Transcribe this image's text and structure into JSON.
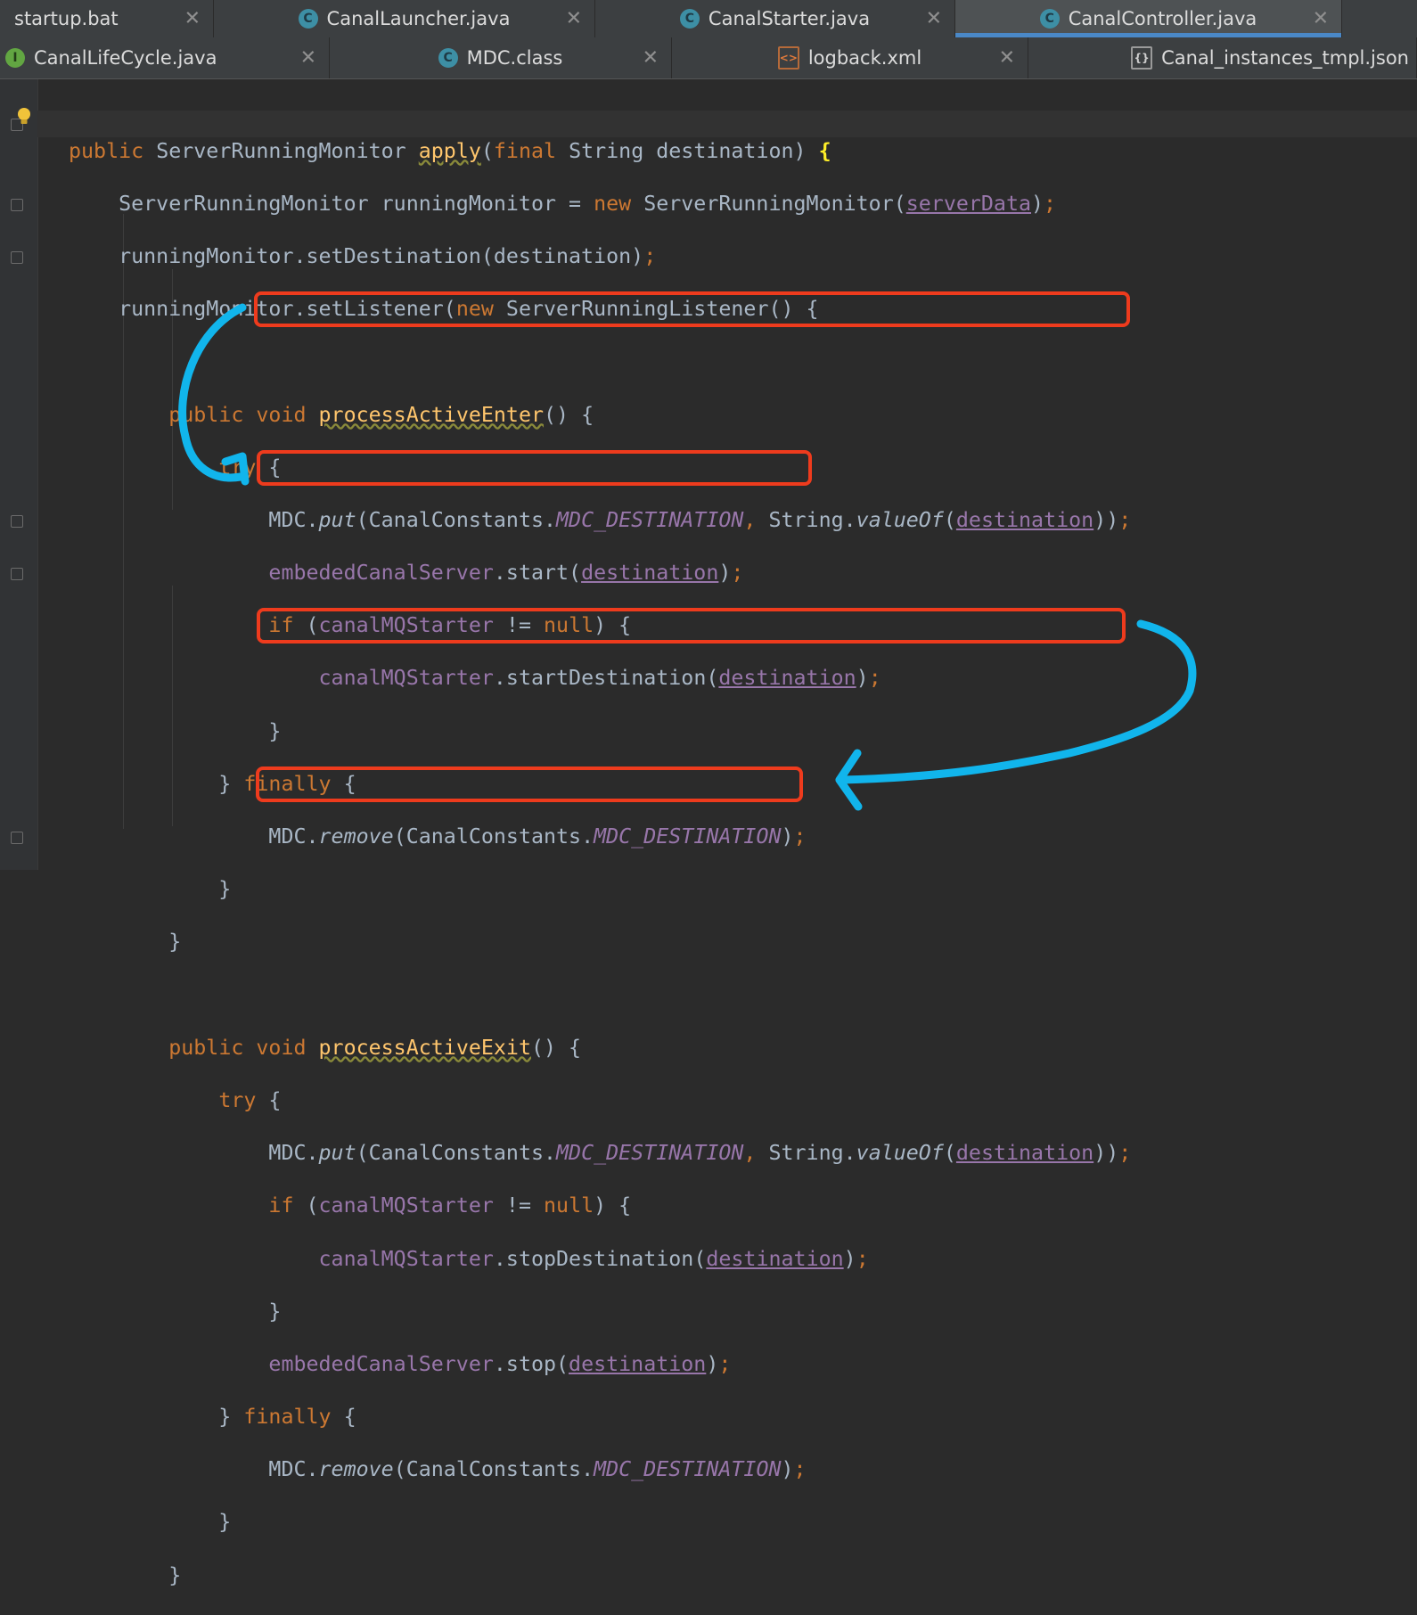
{
  "tabs_row1": [
    {
      "label": "startup.bat",
      "icon": "bat-file-icon",
      "active": false
    },
    {
      "label": "CanalLauncher.java",
      "icon": "class-icon",
      "active": false
    },
    {
      "label": "CanalStarter.java",
      "icon": "class-icon",
      "active": false
    },
    {
      "label": "CanalController.java",
      "icon": "class-icon",
      "active": true
    }
  ],
  "tabs_row2": [
    {
      "label": "CanalLifeCycle.java",
      "icon": "interface-icon"
    },
    {
      "label": "MDC.class",
      "icon": "class-icon"
    },
    {
      "label": "logback.xml",
      "icon": "xml-file-icon"
    },
    {
      "label": "Canal_instances_tmpl.json",
      "icon": "json-file-icon"
    }
  ],
  "icon_letters": {
    "class": "C",
    "interface": "I"
  },
  "close_glyph": "✕",
  "colors": {
    "keyword": "#cc7832",
    "method": "#ffc66d",
    "field": "#9876aa",
    "text": "#a9b7c6",
    "background": "#2b2b2b",
    "annotation_box": "#ee3b1d",
    "annotation_arrow": "#11b5ec"
  },
  "code": {
    "lines": [
      "public ServerRunningMonitor apply(final String destination) {",
      "    ServerRunningMonitor runningMonitor = new ServerRunningMonitor(serverData);",
      "    runningMonitor.setDestination(destination);",
      "    runningMonitor.setListener(new ServerRunningListener() {",
      "",
      "        public void processActiveEnter() {",
      "            try {",
      "                MDC.put(CanalConstants.MDC_DESTINATION, String.valueOf(destination));",
      "                embededCanalServer.start(destination);",
      "                if (canalMQStarter != null) {",
      "                    canalMQStarter.startDestination(destination);",
      "                }",
      "            } finally {",
      "                MDC.remove(CanalConstants.MDC_DESTINATION);",
      "            }",
      "        }",
      "",
      "        public void processActiveExit() {",
      "            try {",
      "                MDC.put(CanalConstants.MDC_DESTINATION, String.valueOf(destination));",
      "                if (canalMQStarter != null) {",
      "                    canalMQStarter.stopDestination(destination);",
      "                }",
      "                embededCanalServer.stop(destination);",
      "            } finally {",
      "                MDC.remove(CanalConstants.MDC_DESTINATION);",
      "            }",
      "        }"
    ]
  }
}
